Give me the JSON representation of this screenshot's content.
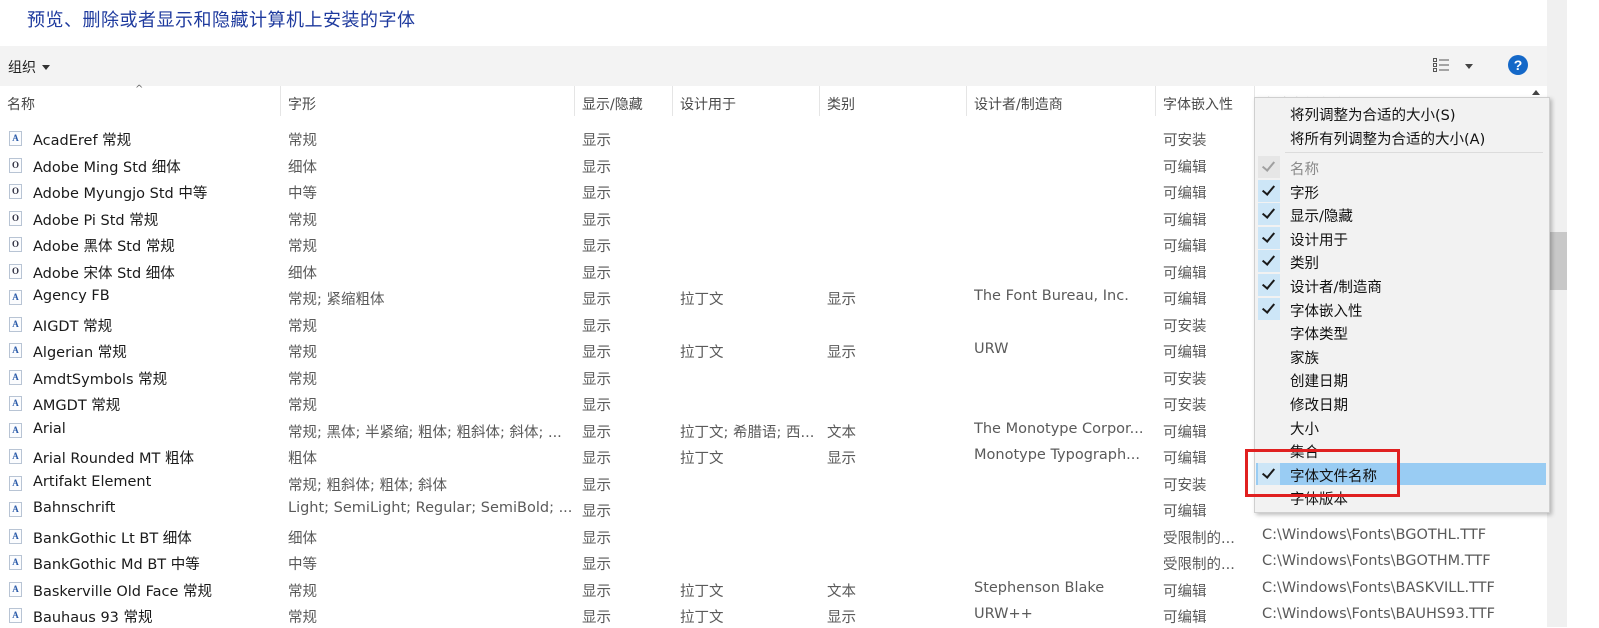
{
  "title": "预览、删除或者显示和隐藏计算机上安装的字体",
  "toolbar": {
    "organize_label": "组织",
    "help_label": "?"
  },
  "columns": [
    "名称",
    "字形",
    "显示/隐藏",
    "设计用于",
    "类别",
    "设计者/制造商",
    "字体嵌入性",
    "字体文件名称"
  ],
  "fonts": [
    {
      "name": "AcadEref 常规",
      "glyph": "常规",
      "vis": "显示",
      "design": "",
      "cat": "",
      "maker": "",
      "embed": "可安装",
      "file": "",
      "icon": "A"
    },
    {
      "name": "Adobe Ming Std 细体",
      "glyph": "细体",
      "vis": "显示",
      "design": "",
      "cat": "",
      "maker": "",
      "embed": "可编辑",
      "file": "",
      "icon": "O"
    },
    {
      "name": "Adobe Myungjo Std 中等",
      "glyph": "中等",
      "vis": "显示",
      "design": "",
      "cat": "",
      "maker": "",
      "embed": "可编辑",
      "file": "",
      "icon": "O"
    },
    {
      "name": "Adobe Pi Std 常规",
      "glyph": "常规",
      "vis": "显示",
      "design": "",
      "cat": "",
      "maker": "",
      "embed": "可编辑",
      "file": "",
      "icon": "O"
    },
    {
      "name": "Adobe 黑体 Std 常规",
      "glyph": "常规",
      "vis": "显示",
      "design": "",
      "cat": "",
      "maker": "",
      "embed": "可编辑",
      "file": "",
      "icon": "O"
    },
    {
      "name": "Adobe 宋体 Std 细体",
      "glyph": "细体",
      "vis": "显示",
      "design": "",
      "cat": "",
      "maker": "",
      "embed": "可编辑",
      "file": "",
      "icon": "O"
    },
    {
      "name": "Agency FB",
      "glyph": "常规; 紧缩粗体",
      "vis": "显示",
      "design": "拉丁文",
      "cat": "显示",
      "maker": "The Font Bureau, Inc.",
      "embed": "可编辑",
      "file": "",
      "icon": "A"
    },
    {
      "name": "AIGDT 常规",
      "glyph": "常规",
      "vis": "显示",
      "design": "",
      "cat": "",
      "maker": "",
      "embed": "可安装",
      "file": "",
      "icon": "A"
    },
    {
      "name": "Algerian 常规",
      "glyph": "常规",
      "vis": "显示",
      "design": "拉丁文",
      "cat": "显示",
      "maker": "URW",
      "embed": "可编辑",
      "file": "",
      "icon": "A"
    },
    {
      "name": "AmdtSymbols 常规",
      "glyph": "常规",
      "vis": "显示",
      "design": "",
      "cat": "",
      "maker": "",
      "embed": "可安装",
      "file": "",
      "icon": "A"
    },
    {
      "name": "AMGDT 常规",
      "glyph": "常规",
      "vis": "显示",
      "design": "",
      "cat": "",
      "maker": "",
      "embed": "可安装",
      "file": "",
      "icon": "A"
    },
    {
      "name": "Arial",
      "glyph": "常规; 黑体; 半紧缩; 粗体; 粗斜体; 斜体; ...",
      "vis": "显示",
      "design": "拉丁文; 希腊语; 西...",
      "cat": "文本",
      "maker": "The Monotype Corpor...",
      "embed": "可编辑",
      "file": "",
      "icon": "A"
    },
    {
      "name": "Arial Rounded MT 粗体",
      "glyph": "粗体",
      "vis": "显示",
      "design": "拉丁文",
      "cat": "显示",
      "maker": "Monotype Typograph...",
      "embed": "可编辑",
      "file": "",
      "icon": "A"
    },
    {
      "name": "Artifakt Element",
      "glyph": "常规; 粗斜体; 粗体; 斜体",
      "vis": "显示",
      "design": "",
      "cat": "",
      "maker": "",
      "embed": "可安装",
      "file": "",
      "icon": "A"
    },
    {
      "name": "Bahnschrift",
      "glyph": "Light; SemiLight; Regular; SemiBold; ...",
      "vis": "显示",
      "design": "",
      "cat": "",
      "maker": "",
      "embed": "可编辑",
      "file": "",
      "icon": "A"
    },
    {
      "name": "BankGothic Lt BT 细体",
      "glyph": "细体",
      "vis": "显示",
      "design": "",
      "cat": "",
      "maker": "",
      "embed": "受限制的...",
      "file": "C:\\Windows\\Fonts\\BGOTHL.TTF",
      "icon": "A"
    },
    {
      "name": "BankGothic Md BT 中等",
      "glyph": "中等",
      "vis": "显示",
      "design": "",
      "cat": "",
      "maker": "",
      "embed": "受限制的...",
      "file": "C:\\Windows\\Fonts\\BGOTHM.TTF",
      "icon": "A"
    },
    {
      "name": "Baskerville Old Face 常规",
      "glyph": "常规",
      "vis": "显示",
      "design": "拉丁文",
      "cat": "文本",
      "maker": "Stephenson Blake",
      "embed": "可编辑",
      "file": "C:\\Windows\\Fonts\\BASKVILL.TTF",
      "icon": "A"
    },
    {
      "name": "Bauhaus 93 常规",
      "glyph": "常规",
      "vis": "显示",
      "design": "拉丁文",
      "cat": "显示",
      "maker": "URW++",
      "embed": "可编辑",
      "file": "C:\\Windows\\Fonts\\BAUHS93.TTF",
      "icon": "A"
    }
  ],
  "menu": {
    "size_col": "将列调整为合适的大小(S)",
    "size_all": "将所有列调整为合适的大小(A)",
    "items": [
      {
        "label": "名称",
        "checked": true,
        "disabled": true
      },
      {
        "label": "字形",
        "checked": true,
        "disabled": false
      },
      {
        "label": "显示/隐藏",
        "checked": true,
        "disabled": false
      },
      {
        "label": "设计用于",
        "checked": true,
        "disabled": false
      },
      {
        "label": "类别",
        "checked": true,
        "disabled": false
      },
      {
        "label": "设计者/制造商",
        "checked": true,
        "disabled": false
      },
      {
        "label": "字体嵌入性",
        "checked": true,
        "disabled": false
      },
      {
        "label": "字体类型",
        "checked": false,
        "disabled": false
      },
      {
        "label": "家族",
        "checked": false,
        "disabled": false
      },
      {
        "label": "创建日期",
        "checked": false,
        "disabled": false
      },
      {
        "label": "修改日期",
        "checked": false,
        "disabled": false
      },
      {
        "label": "大小",
        "checked": false,
        "disabled": false
      },
      {
        "label": "集合",
        "checked": false,
        "disabled": false
      },
      {
        "label": "字体文件名称",
        "checked": true,
        "disabled": false,
        "highlighted": true
      },
      {
        "label": "字体版本",
        "checked": false,
        "disabled": false
      }
    ]
  },
  "colors": {
    "title": "#1e3a9e",
    "highlight": "#99ccf3",
    "check_bg": "#cde6f7",
    "annotation": "#e02020",
    "help": "#1468c8"
  }
}
